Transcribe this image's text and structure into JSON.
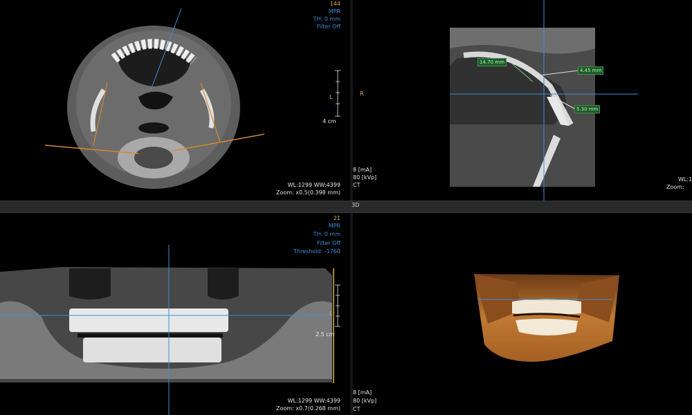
{
  "top_left": {
    "slice_number": "144",
    "mode": "MPR",
    "thickness": "TH: 0 mm",
    "filter": "Filter Off",
    "orientation_marker": "L",
    "scale_label": "4 cm",
    "window": "WL:1299 WW:4399",
    "zoom": "Zoom: x0.5(0.398 mm)"
  },
  "top_right": {
    "orientation_marker": "R",
    "ma": "8 [mA]",
    "kvp": "80 [kVp]",
    "modality": "CT",
    "window_partial": "WL:1",
    "zoom_partial": "Zoom:",
    "measurements": [
      "14.70 mm",
      "4.45 mm",
      "5.30 mm"
    ]
  },
  "divider": {
    "label_3d": "3D"
  },
  "bottom_left": {
    "slice_number": "21",
    "mode": "MPR",
    "thickness": "TH: 0 mm",
    "filter": "Filter Off",
    "threshold": "Threshold: -1760",
    "orientation_marker": "L",
    "scale_label": "2.5 cm",
    "window": "WL:1299 WW:4399",
    "zoom": "Zoom: x0.7(0.268 mm)"
  },
  "bottom_right": {
    "ma": "8 [mA]",
    "kvp": "80 [kVp]",
    "modality": "CT"
  },
  "colors": {
    "overlay_blue": "#3d8fd8",
    "overlay_gold": "#e3b64a",
    "measure_green": "#1f5a2a"
  }
}
